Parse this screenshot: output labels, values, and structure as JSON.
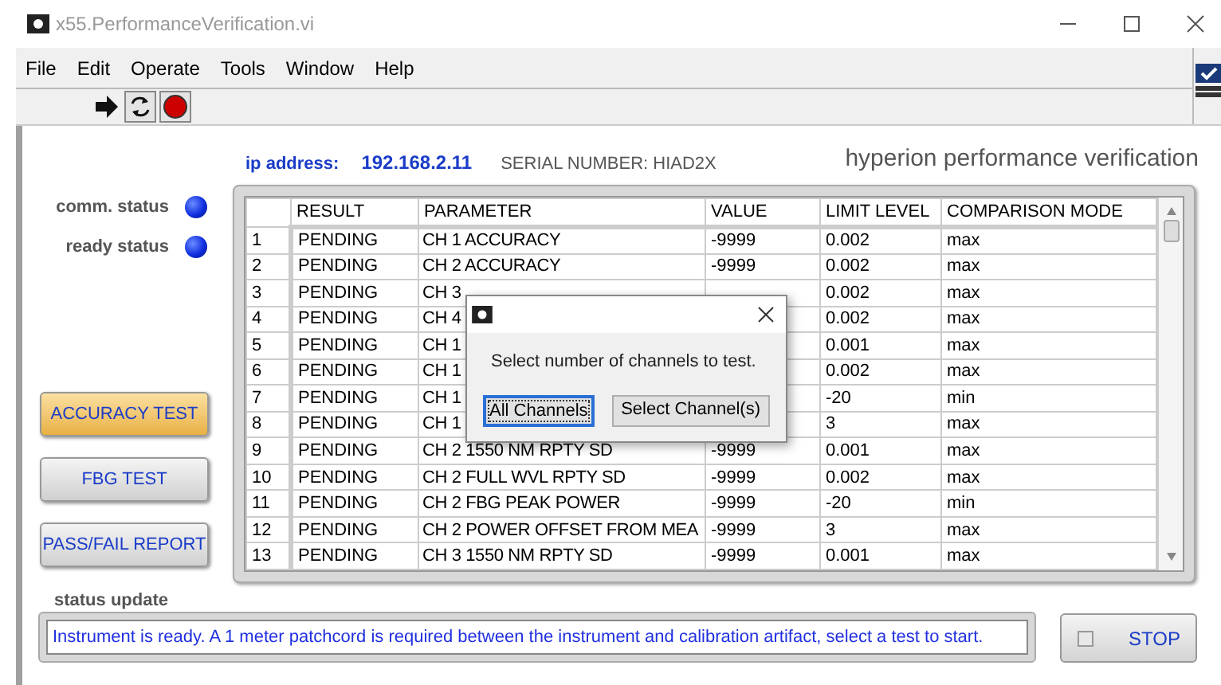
{
  "window": {
    "title": "x55.PerformanceVerification.vi"
  },
  "menu": [
    "File",
    "Edit",
    "Operate",
    "Tools",
    "Window",
    "Help"
  ],
  "header": {
    "ip_label": "ip address:",
    "ip_value": "192.168.2.11",
    "serial": "SERIAL NUMBER: HIAD2X",
    "title": "hyperion performance verification"
  },
  "indicators": [
    {
      "label": "comm. status",
      "on": true
    },
    {
      "label": "ready status",
      "on": true
    }
  ],
  "buttons": [
    {
      "label": "ACCURACY TEST",
      "selected": true
    },
    {
      "label": "FBG TEST",
      "selected": false
    },
    {
      "label": "PASS/FAIL REPORT",
      "selected": false
    }
  ],
  "table": {
    "columns": [
      "RESULT",
      "PARAMETER",
      "VALUE",
      "LIMIT LEVEL",
      "COMPARISON MODE"
    ],
    "rows": [
      {
        "index": "1",
        "result": "PENDING",
        "parameter": "CH 1 ACCURACY",
        "value": "-9999",
        "limit": "0.002",
        "mode": "max"
      },
      {
        "index": "2",
        "result": "PENDING",
        "parameter": "CH 2 ACCURACY",
        "value": "-9999",
        "limit": "0.002",
        "mode": "max"
      },
      {
        "index": "3",
        "result": "PENDING",
        "parameter": "CH 3",
        "limit": "0.002",
        "mode": "max"
      },
      {
        "index": "4",
        "result": "PENDING",
        "parameter": "CH 4",
        "limit": "0.002",
        "mode": "max"
      },
      {
        "index": "5",
        "result": "PENDING",
        "parameter": "CH 1",
        "limit": "0.001",
        "mode": "max"
      },
      {
        "index": "6",
        "result": "PENDING",
        "parameter": "CH 1",
        "limit": "0.002",
        "mode": "max"
      },
      {
        "index": "7",
        "result": "PENDING",
        "parameter": "CH 1",
        "limit": "-20",
        "mode": "min"
      },
      {
        "index": "8",
        "result": "PENDING",
        "parameter": "CH 1",
        "limit": "3",
        "mode": "max"
      },
      {
        "index": "9",
        "result": "PENDING",
        "parameter": "CH 2 1550 NM RPTY SD",
        "value": "-9999",
        "limit": "0.001",
        "mode": "max"
      },
      {
        "index": "10",
        "result": "PENDING",
        "parameter": "CH 2 FULL WVL RPTY SD",
        "value": "-9999",
        "limit": "0.002",
        "mode": "max"
      },
      {
        "index": "11",
        "result": "PENDING",
        "parameter": "CH 2 FBG PEAK POWER",
        "value": "-9999",
        "limit": "-20",
        "mode": "min"
      },
      {
        "index": "12",
        "result": "PENDING",
        "parameter": "CH 2 POWER OFFSET FROM MEA",
        "value": "-9999",
        "limit": "3",
        "mode": "max"
      },
      {
        "index": "13",
        "result": "PENDING",
        "parameter": "CH 3 1550 NM RPTY SD",
        "value": "-9999",
        "limit": "0.001",
        "mode": "max"
      }
    ]
  },
  "status": {
    "label": "status update",
    "message": "Instrument is ready.  A 1 meter patchcord is required between the instrument and calibration artifact, select a test to start."
  },
  "stop_button": {
    "label": "STOP",
    "checked": false
  },
  "dialog": {
    "message": "Select number of channels to test.",
    "buttons": [
      {
        "label": "All Channels",
        "focused": true
      },
      {
        "label": "Select Channel(s)",
        "focused": false
      }
    ]
  }
}
